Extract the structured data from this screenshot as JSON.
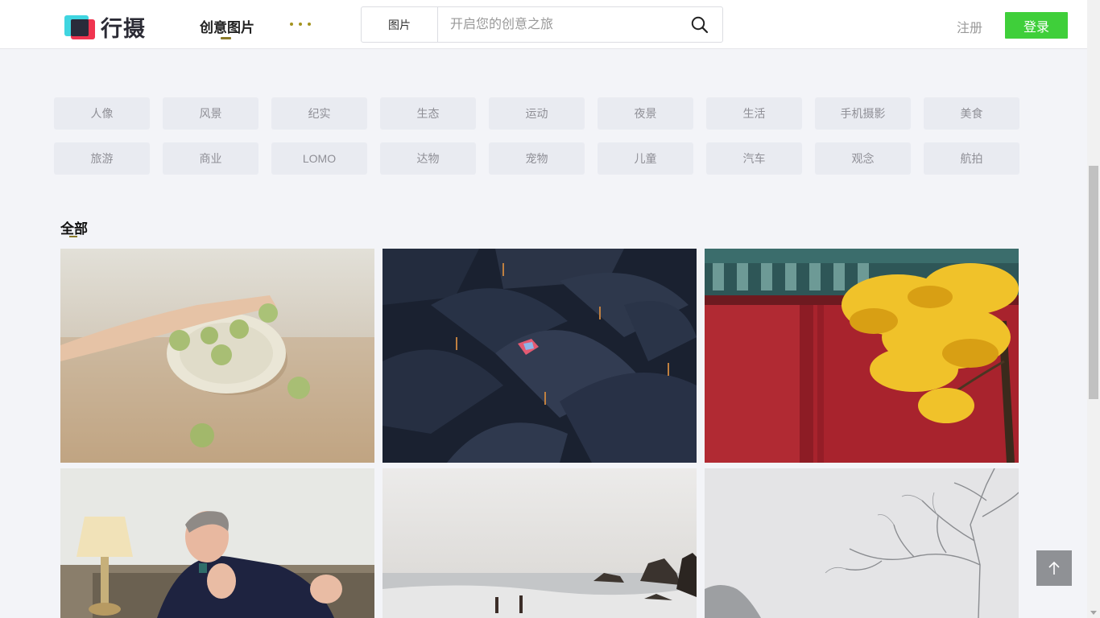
{
  "header": {
    "logo_text": "行摄",
    "nav_label": "创意图片",
    "search": {
      "type_label": "图片",
      "placeholder": "开启您的创意之旅"
    },
    "register_label": "注册",
    "login_label": "登录"
  },
  "tags": {
    "items": [
      {
        "label": "人像"
      },
      {
        "label": "风景"
      },
      {
        "label": "纪实"
      },
      {
        "label": "生态"
      },
      {
        "label": "运动"
      },
      {
        "label": "夜景"
      },
      {
        "label": "生活"
      },
      {
        "label": "手机摄影"
      },
      {
        "label": "美食"
      },
      {
        "label": "旅游"
      },
      {
        "label": "商业"
      },
      {
        "label": "LOMO"
      },
      {
        "label": "达物"
      },
      {
        "label": "宠物"
      },
      {
        "label": "儿童"
      },
      {
        "label": "汽车"
      },
      {
        "label": "观念"
      },
      {
        "label": "航拍"
      }
    ]
  },
  "section": {
    "title": "全部"
  },
  "colors": {
    "accent": "#3fcf3a",
    "underline": "#8a7a2a",
    "more_dots": "#a3931f",
    "tag_bg": "#e9ebf1",
    "page_bg": "#f3f4f8"
  },
  "icons": {
    "search": "search-icon",
    "more": "more-dots-icon",
    "back_to_top": "arrow-up-icon"
  }
}
